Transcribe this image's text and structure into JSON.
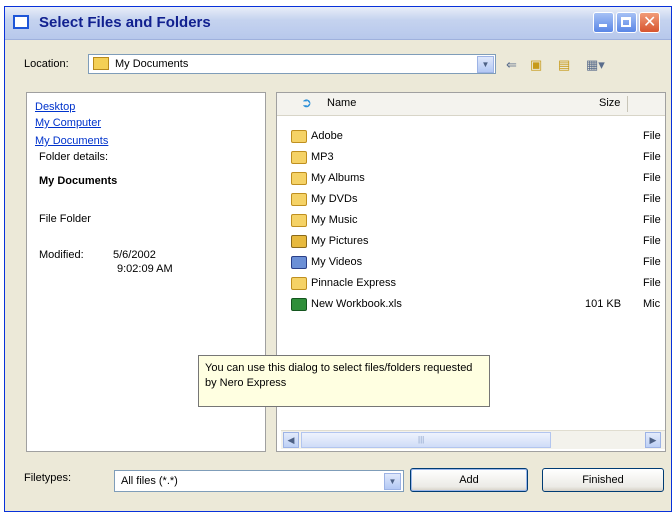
{
  "window": {
    "title": "Select Files and Folders"
  },
  "location": {
    "label": "Location:",
    "value": "My Documents"
  },
  "left_panel": {
    "links": [
      "Desktop",
      "My Computer",
      "My Documents"
    ],
    "folder_details_label": "Folder details:",
    "folder_name": "My Documents",
    "folder_type": "File Folder",
    "modified_label": "Modified:",
    "modified_date": "5/6/2002",
    "modified_time": "9:02:09 AM"
  },
  "file_list": {
    "columns": {
      "name": "Name",
      "size": "Size"
    },
    "rows": [
      {
        "name": "Adobe",
        "size": "",
        "type": "File",
        "icon": "folder-icon"
      },
      {
        "name": "MP3",
        "size": "",
        "type": "File",
        "icon": "folder-icon"
      },
      {
        "name": "My Albums",
        "size": "",
        "type": "File",
        "icon": "folder-icon"
      },
      {
        "name": "My DVDs",
        "size": "",
        "type": "File",
        "icon": "folder-icon"
      },
      {
        "name": "My Music",
        "size": "",
        "type": "File",
        "icon": "music-folder-icon"
      },
      {
        "name": "My Pictures",
        "size": "",
        "type": "File",
        "icon": "pictures-folder-icon"
      },
      {
        "name": "My Videos",
        "size": "",
        "type": "File",
        "icon": "videos-folder-icon"
      },
      {
        "name": "Pinnacle Express",
        "size": "",
        "type": "File",
        "icon": "folder-icon"
      },
      {
        "name": "New Workbook.xls",
        "size": "101 KB",
        "type": "Mic",
        "icon": "excel-file-icon"
      }
    ]
  },
  "tooltip": {
    "text": "You can use this dialog to select files/folders requested by Nero Express"
  },
  "filetypes": {
    "label": "Filetypes:",
    "value": "All files (*.*)"
  },
  "buttons": {
    "add": "Add",
    "finished": "Finished"
  }
}
